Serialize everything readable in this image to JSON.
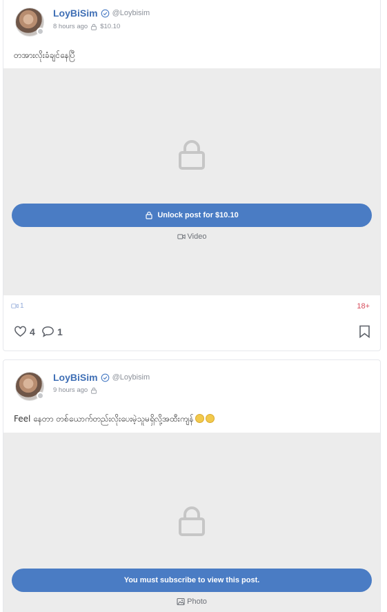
{
  "posts": [
    {
      "author": {
        "name": "LoyBiSim",
        "handle": "@Loybisim"
      },
      "time": "8 hours ago",
      "price": "$10.10",
      "caption": "တအားလိုးခံချင်နေပြီ",
      "unlock_label": "Unlock post for $10.10",
      "media_type": "Video",
      "video_count": "1",
      "adult_badge": "18+",
      "likes": "4",
      "comments": "1"
    },
    {
      "author": {
        "name": "LoyBiSim",
        "handle": "@Loybisim"
      },
      "time": "9 hours ago",
      "caption": "Feel နေတာ တစ်ယောက်တည်းလိုးပေးမဲ့သူမရှိလို့အထီးကျန်",
      "emojis": [
        "sad-face-emoji",
        "sad-face-emoji"
      ],
      "unlock_label": "You must subscribe to view this post.",
      "media_type": "Photo"
    }
  ],
  "icons": {
    "verified": "verified-check-icon",
    "lock": "lock-icon",
    "video": "video-camera-icon",
    "photo": "image-icon",
    "like": "heart-icon",
    "comment": "comment-icon",
    "bookmark": "bookmark-icon"
  },
  "colors": {
    "accent": "#4a7cc4",
    "name": "#3f6fb5",
    "adult": "#d64b5a",
    "media_bg": "#ececec"
  }
}
